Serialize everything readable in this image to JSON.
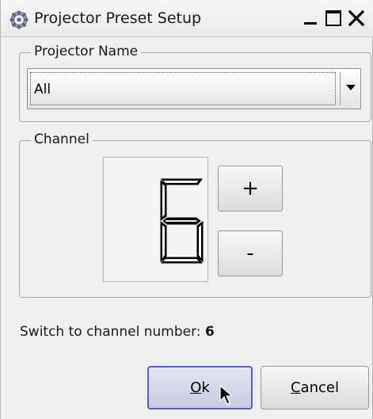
{
  "window": {
    "title": "Projector Preset Setup",
    "icons": {
      "app": "gear-icon",
      "minimize": "minimize-icon",
      "maximize": "maximize-icon",
      "close": "close-icon"
    }
  },
  "projector_group": {
    "legend": "Projector Name",
    "selected": "All",
    "arrow_icon": "dropdown-arrow-icon"
  },
  "channel_group": {
    "legend": "Channel",
    "display_value": "6",
    "plus_label": "+",
    "minus_label": "-"
  },
  "status": {
    "prefix": "Switch to channel number:",
    "value": "6"
  },
  "buttons": {
    "ok_mnemonic": "O",
    "ok_rest": "k",
    "cancel_mnemonic": "C",
    "cancel_rest": "ancel"
  },
  "colors": {
    "ok_border": "#5b63b5",
    "window_bg": "#efefef",
    "lcd_segment": "#000000"
  },
  "cursor_icon": "mouse-pointer-icon"
}
